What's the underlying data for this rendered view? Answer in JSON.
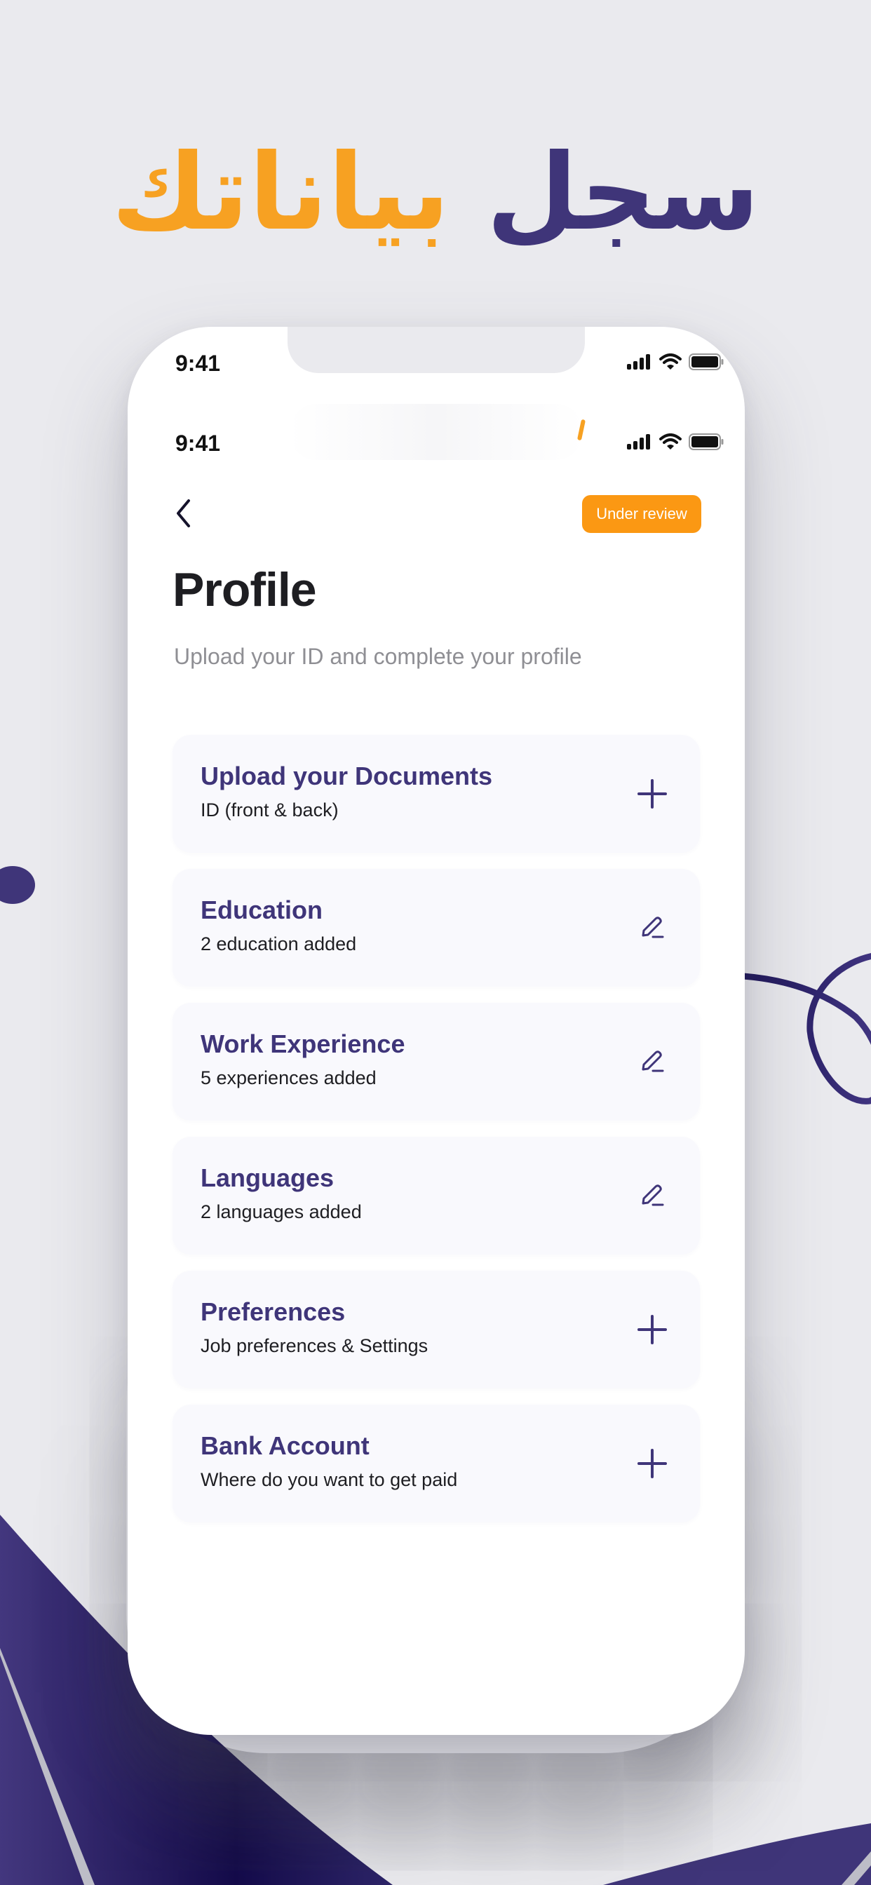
{
  "headline": {
    "word_primary": "سجل",
    "word_accent": "بياناتك",
    "primary_color": "#3F3579",
    "accent_color": "#F7A122"
  },
  "status_bar": {
    "time": "9:41",
    "icons": [
      "cellular-signal-icon",
      "wifi-icon",
      "battery-icon"
    ]
  },
  "header": {
    "back_icon": "chevron-left-icon",
    "status_badge": "Under review",
    "badge_color": "#FB9813"
  },
  "page": {
    "title": "Profile",
    "subtitle": "Upload your ID and complete your profile"
  },
  "sections": [
    {
      "title": "Upload your Documents",
      "description": "ID (front & back)",
      "action_icon": "plus-icon"
    },
    {
      "title": "Education",
      "description": "2 education added",
      "action_icon": "pencil-icon"
    },
    {
      "title": "Work Experience",
      "description": "5 experiences added",
      "action_icon": "pencil-icon"
    },
    {
      "title": "Languages",
      "description": "2 languages added",
      "action_icon": "pencil-icon"
    },
    {
      "title": "Preferences",
      "description": "Job preferences & Settings",
      "action_icon": "plus-icon"
    },
    {
      "title": "Bank Account",
      "description": "Where do you want to get paid",
      "action_icon": "plus-icon"
    }
  ],
  "colors": {
    "brand_purple": "#3F3579",
    "brand_orange": "#F7A122",
    "background": "#EAEAEE",
    "card_background": "#F9F9FD"
  }
}
